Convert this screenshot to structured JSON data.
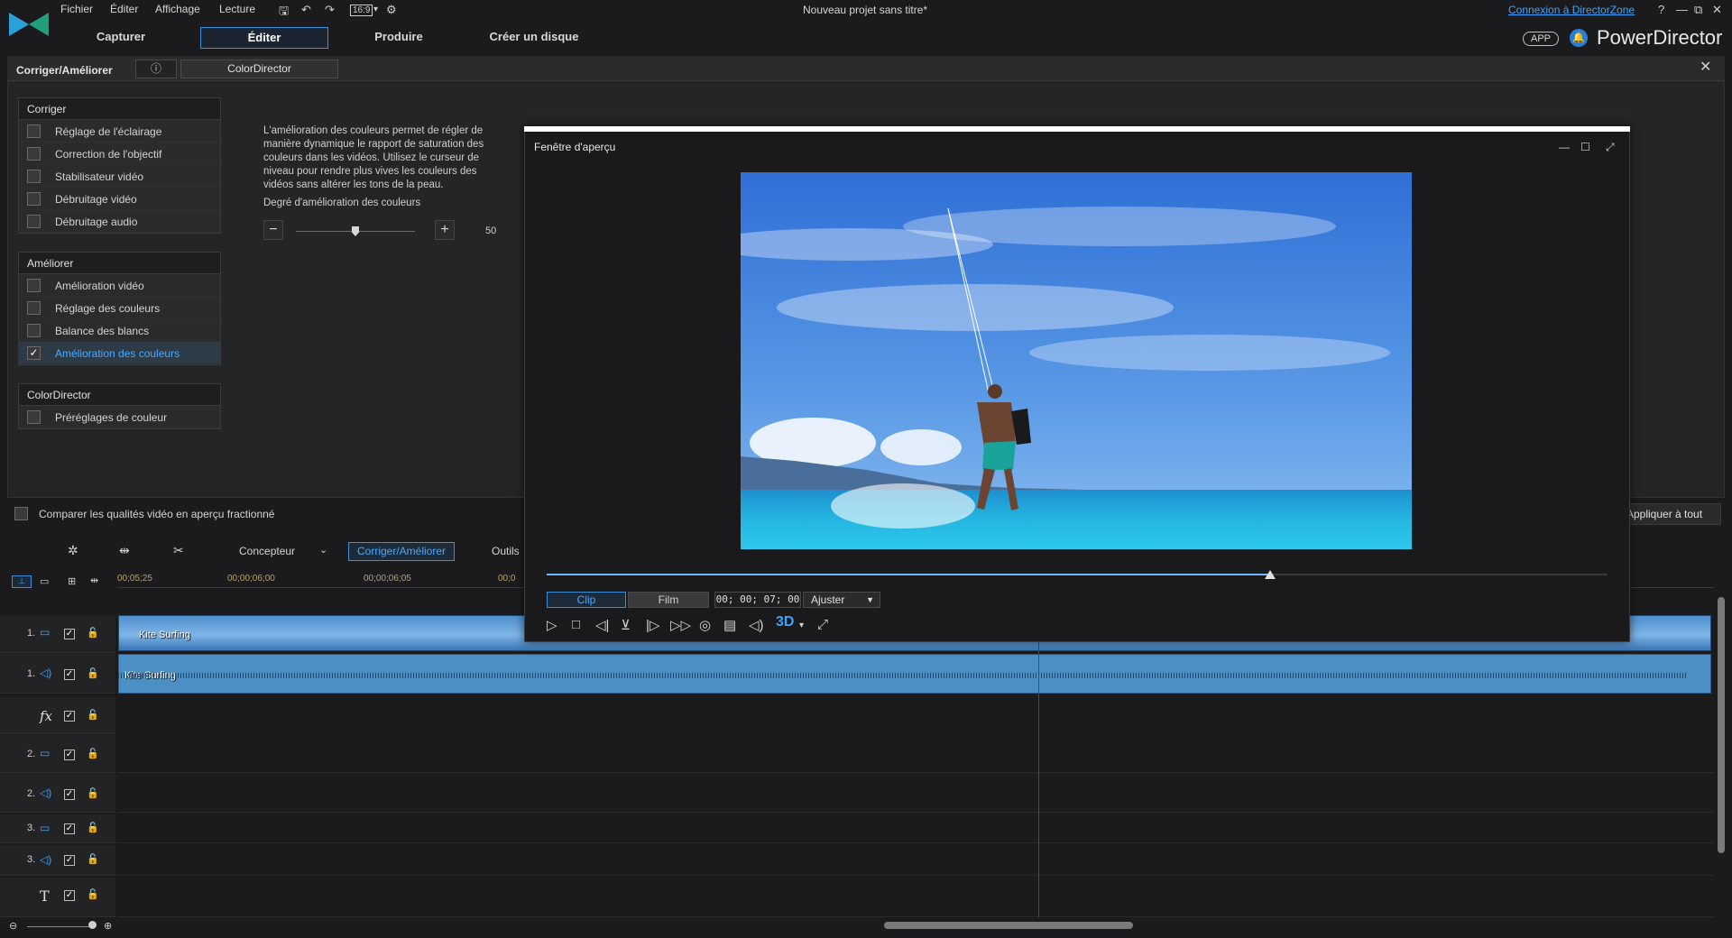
{
  "menu": [
    "Fichier",
    "Éditer",
    "Affichage",
    "Lecture"
  ],
  "window_title": "Nouveau projet sans titre*",
  "director_zone_link": "Connexion à DirectorZone",
  "aspect_ratio": "16:9",
  "tabs": [
    "Capturer",
    "Éditer",
    "Produire",
    "Créer un disque"
  ],
  "active_tab": "Éditer",
  "brand": {
    "app_badge": "APP",
    "name": "PowerDirector"
  },
  "panel": {
    "title": "Corriger/Améliorer",
    "info_label": "ⓘ",
    "colordirector_button": "ColorDirector"
  },
  "groups": {
    "corriger": {
      "title": "Corriger",
      "items": [
        "Réglage de l'éclairage",
        "Correction de l'objectif",
        "Stabilisateur vidéo",
        "Débruitage vidéo",
        "Débruitage audio"
      ]
    },
    "ameliorer": {
      "title": "Améliorer",
      "items": [
        "Amélioration vidéo",
        "Réglage des couleurs",
        "Balance des blancs",
        "Amélioration des couleurs"
      ],
      "checked": "Amélioration des couleurs"
    },
    "colordirector": {
      "title": "ColorDirector",
      "items": [
        "Préréglages de couleur"
      ]
    }
  },
  "description": "L'amélioration des couleurs permet de régler de manière dynamique le rapport de saturation des couleurs dans les vidéos. Utilisez le curseur de niveau pour rendre plus vives les couleurs des vidéos sans altérer les tons de la peau.",
  "degree": {
    "label": "Degré d'amélioration des couleurs",
    "value": "50",
    "level": 0.5
  },
  "compare_label": "Comparer les qualités vidéo en aperçu fractionné",
  "apply_all": "Appliquer à tout",
  "toolbar": {
    "designer": "Concepteur",
    "fix_enhance": "Corriger/Améliorer",
    "tools": "Outils"
  },
  "ruler_labels": [
    "00;05;25",
    "00;00;06;00",
    "00;00;06;05",
    "00;0"
  ],
  "tracks": [
    {
      "num": "1.",
      "type": "video"
    },
    {
      "num": "1.",
      "type": "audio"
    },
    {
      "num": "",
      "type": "fx"
    },
    {
      "num": "2.",
      "type": "video"
    },
    {
      "num": "2.",
      "type": "audio"
    },
    {
      "num": "3.",
      "type": "video"
    },
    {
      "num": "3.",
      "type": "audio"
    },
    {
      "num": "",
      "type": "title"
    }
  ],
  "clip_name": "Kite Surfing",
  "preview": {
    "title": "Fenêtre d'aperçu",
    "tab_clip": "Clip",
    "tab_film": "Film",
    "timecode": "00; 00; 07; 00",
    "fit": "Ajuster",
    "three_d": "3D",
    "progress": 0.68
  },
  "colors": {
    "accent": "#3aa5ff",
    "active_border": "#3a8fd8",
    "playhead": "#c01a1a"
  }
}
